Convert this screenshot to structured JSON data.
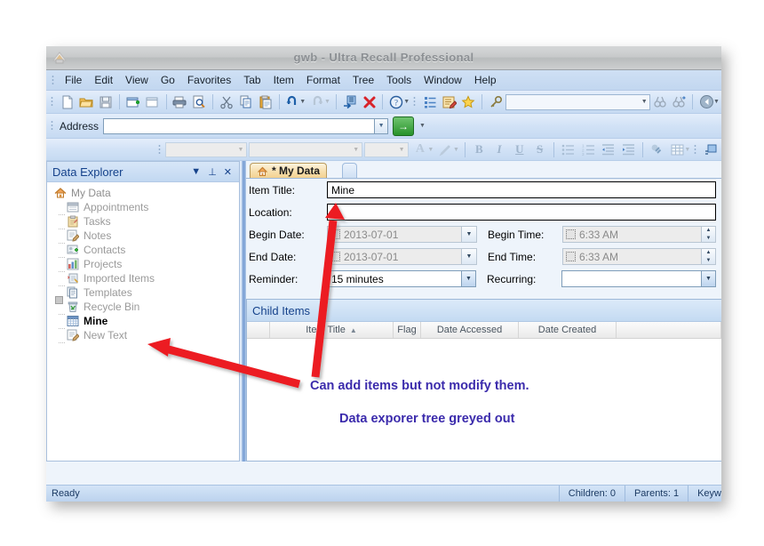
{
  "window": {
    "title": "gwb - Ultra Recall Professional",
    "app_icon": "ultra-recall-icon"
  },
  "menubar": {
    "items": [
      "File",
      "Edit",
      "View",
      "Go",
      "Favorites",
      "Tab",
      "Item",
      "Format",
      "Tree",
      "Tools",
      "Window",
      "Help"
    ]
  },
  "toolbar_main": {
    "buttons": [
      "new-document-icon",
      "open-folder-icon",
      "save-icon",
      "new-item-icon",
      "new-child-item-icon",
      "print-icon",
      "print-preview-icon",
      "cut-scissors-icon",
      "copy-icon",
      "paste-icon",
      "undo-icon",
      "redo-icon",
      "arrange-icon",
      "delete-x-icon",
      "help-question-icon"
    ],
    "buttons2": [
      "outline-list-icon",
      "edit-note-icon",
      "favorite-star-icon",
      "search-key-icon"
    ],
    "search_value": "",
    "buttons3": [
      "find-prev-icon",
      "find-next-icon",
      "back-navigate-icon"
    ]
  },
  "address_bar": {
    "label": "Address",
    "value": "",
    "placeholder": "",
    "go_label": "→"
  },
  "format_toolbar": {
    "style_combo": "",
    "font_combo": "",
    "size_combo": "",
    "font_color_label": "A",
    "highlight_label": "✎",
    "bold": "B",
    "italic": "I",
    "underline": "U",
    "strike": "S",
    "buttons": [
      "bullet-list-icon",
      "numbered-list-icon",
      "decrease-indent-icon",
      "increase-indent-icon",
      "hyperlink-icon",
      "insert-table-icon"
    ]
  },
  "explorer": {
    "title": "Data Explorer",
    "header_icons": [
      "chevron-down-icon",
      "pin-icon",
      "close-icon"
    ],
    "tree": [
      {
        "label": "My Data",
        "icon": "home-icon",
        "level": 0,
        "bold": false,
        "expander": "none"
      },
      {
        "label": "Appointments",
        "icon": "calendar-icon",
        "level": 1,
        "bold": false,
        "expander": "dash"
      },
      {
        "label": "Tasks",
        "icon": "clipboard-icon",
        "level": 1,
        "bold": false,
        "expander": "dash"
      },
      {
        "label": "Notes",
        "icon": "note-pencil-icon",
        "level": 1,
        "bold": false,
        "expander": "dash"
      },
      {
        "label": "Contacts",
        "icon": "contact-card-icon",
        "level": 1,
        "bold": false,
        "expander": "dash"
      },
      {
        "label": "Projects",
        "icon": "grid-chart-icon",
        "level": 1,
        "bold": false,
        "expander": "dash"
      },
      {
        "label": "Imported Items",
        "icon": "imported-items-icon",
        "level": 1,
        "bold": false,
        "expander": "dash"
      },
      {
        "label": "Templates",
        "icon": "templates-icon",
        "level": 1,
        "bold": false,
        "expander": "box"
      },
      {
        "label": "Recycle Bin",
        "icon": "recycle-bin-icon",
        "level": 1,
        "bold": false,
        "expander": "dash"
      },
      {
        "label": "Mine",
        "icon": "calendar-blue-icon",
        "level": 1,
        "bold": true,
        "expander": "dash"
      },
      {
        "label": "New Text",
        "icon": "note-pencil-icon",
        "level": 1,
        "bold": false,
        "expander": "dash"
      }
    ]
  },
  "tabs": [
    {
      "label": "* My Data",
      "icon": "home-icon",
      "active": true
    }
  ],
  "form": {
    "item_title": {
      "label": "Item Title:",
      "value": "Mine"
    },
    "location": {
      "label": "Location:",
      "value": ""
    },
    "begin_date": {
      "label": "Begin Date:",
      "value": "2013-07-01",
      "checked": false
    },
    "begin_time": {
      "label": "Begin Time:",
      "value": "6:33 AM",
      "checked": false
    },
    "end_date": {
      "label": "End Date:",
      "value": "2013-07-01",
      "checked": false
    },
    "end_time": {
      "label": "End Time:",
      "value": "6:33 AM",
      "checked": false
    },
    "reminder": {
      "label": "Reminder:",
      "value": "15 minutes"
    },
    "recurring": {
      "label": "Recurring:",
      "value": ""
    }
  },
  "child_items": {
    "title": "Child Items",
    "columns": [
      "",
      "Item Title",
      "Flag",
      "Date Accessed",
      "Date Created",
      ""
    ],
    "sort_column": "Item Title",
    "sort_indicator": "▲",
    "rows": []
  },
  "status_bar": {
    "ready": "Ready",
    "children": "Children: 0",
    "parents": "Parents: 1",
    "keywords": "Keyw"
  },
  "annotations": {
    "line1": "Can add items but not modify them.",
    "line2": "Data exporer tree greyed out",
    "color": "#3b2bac",
    "arrow_color": "#ec1c24"
  }
}
